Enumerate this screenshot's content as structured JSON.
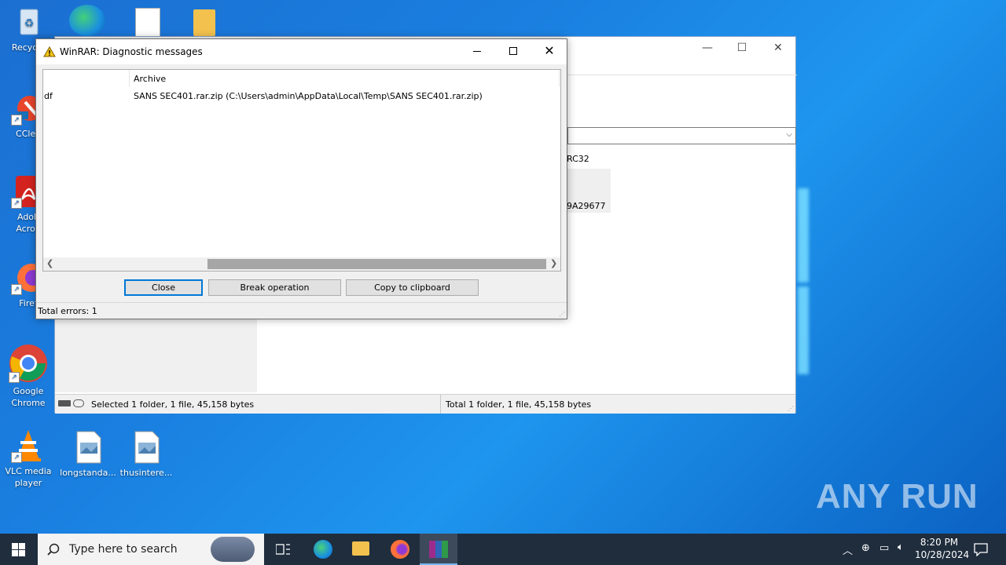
{
  "desktop": {
    "icons": [
      {
        "label": "Recycle",
        "icon": "recycle-bin-icon"
      },
      {
        "label": "CClea",
        "icon": "ccleaner-icon"
      },
      {
        "label": "Adob\nAcrob",
        "icon": "acrobat-icon"
      },
      {
        "label": "Firef",
        "icon": "firefox-icon"
      },
      {
        "label": "Google\nChrome",
        "icon": "chrome-icon"
      },
      {
        "label": "VLC media\nplayer",
        "icon": "vlc-icon"
      },
      {
        "label": "longstanda...",
        "icon": "image-file-icon"
      },
      {
        "label": "thusintere...",
        "icon": "image-file-icon"
      }
    ],
    "watermark": "ANY RUN"
  },
  "bg_window": {
    "status_left": "Selected 1 folder, 1 file, 45,158 bytes",
    "status_right": "Total 1 folder, 1 file, 45,158 bytes",
    "column_partial": "RC32",
    "value_partial": "9A29677"
  },
  "dialog": {
    "title": "WinRAR: Diagnostic messages",
    "columns": [
      "",
      "Archive"
    ],
    "rows": [
      {
        "type": "df",
        "message": "SANS SEC401.rar.zip (C:\\Users\\admin\\AppData\\Local\\Temp\\SANS SEC401.rar.zip)"
      }
    ],
    "buttons": {
      "close": "Close",
      "break": "Break operation",
      "copy": "Copy to clipboard"
    },
    "status": "Total errors: 1"
  },
  "taskbar": {
    "search_placeholder": "Type here to search",
    "time": "8:20 PM",
    "date": "10/28/2024"
  },
  "colors": {
    "accent": "#0078d7",
    "taskbar": "#1f2d3d",
    "desktop": "#1a7fe0"
  }
}
